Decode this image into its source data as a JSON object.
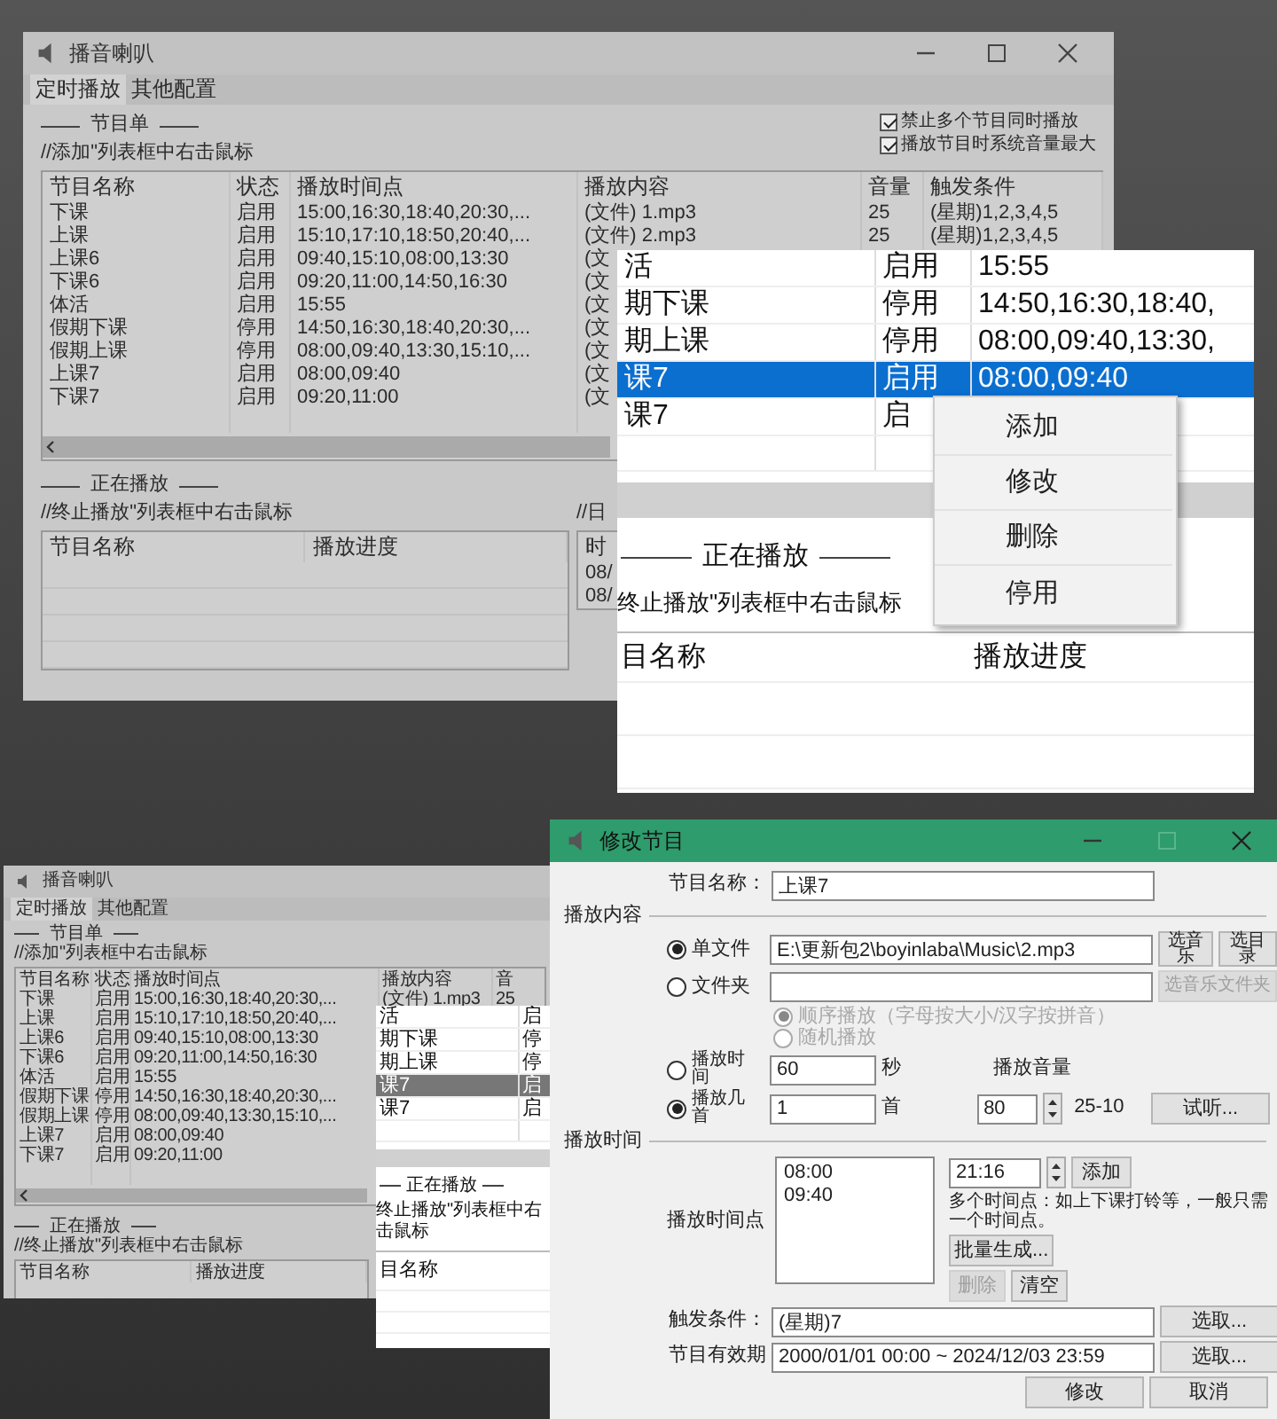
{
  "main_window": {
    "title": "播音喇叭",
    "tabs": [
      {
        "label": "定时播放",
        "selected": true
      },
      {
        "label": "其他配置",
        "selected": false
      }
    ],
    "schedule": {
      "heading": "节目单",
      "hint": "//添加\"列表框中右击鼠标",
      "options": [
        {
          "label": "禁止多个节目同时播放",
          "checked": true
        },
        {
          "label": "播放节目时系统音量最大",
          "checked": true
        }
      ],
      "columns": [
        "节目名称",
        "状态",
        "播放时间点",
        "播放内容",
        "音量",
        "触发条件"
      ],
      "rows": [
        {
          "cells": [
            "下课",
            "启用",
            "15:00,16:30,18:40,20:30,...",
            "(文件) 1.mp3",
            "25",
            "(星期)1,2,3,4,5"
          ]
        },
        {
          "cells": [
            "上课",
            "启用",
            "15:10,17:10,18:50,20:40,...",
            "(文件) 2.mp3",
            "25",
            "(星期)1,2,3,4,5"
          ]
        },
        {
          "cells": [
            "上课6",
            "启用",
            "09:40,15:10,08:00,13:30",
            "(文"
          ]
        },
        {
          "cells": [
            "下课6",
            "启用",
            "09:20,11:00,14:50,16:30",
            "(文"
          ]
        },
        {
          "cells": [
            "体活",
            "启用",
            "15:55",
            "(文"
          ]
        },
        {
          "cells": [
            "假期下课",
            "停用",
            "14:50,16:30,18:40,20:30,...",
            "(文"
          ]
        },
        {
          "cells": [
            "假期上课",
            "停用",
            "08:00,09:40,13:30,15:10,...",
            "(文"
          ]
        },
        {
          "cells": [
            "上课7",
            "启用",
            "08:00,09:40",
            "(文"
          ]
        },
        {
          "cells": [
            "下课7",
            "启用",
            "09:20,11:00",
            "(文"
          ]
        }
      ]
    },
    "playing": {
      "heading": "正在播放",
      "hint": "//终止播放\"列表框中右击鼠标",
      "columns": [
        "节目名称",
        "播放进度"
      ]
    },
    "log": {
      "hint": "//日",
      "column": "时",
      "rows": [
        "08/",
        "08/"
      ]
    }
  },
  "zoom_inset": {
    "rows": [
      {
        "cells": [
          "活",
          "启用",
          "15:55"
        ],
        "selected": false
      },
      {
        "cells": [
          "期下课",
          "停用",
          "14:50,16:30,18:40,"
        ],
        "selected": false
      },
      {
        "cells": [
          "期上课",
          "停用",
          "08:00,09:40,13:30,"
        ],
        "selected": false
      },
      {
        "cells": [
          "课7",
          "启用",
          "08:00,09:40"
        ],
        "selected": true
      },
      {
        "cells": [
          "课7",
          "启"
        ],
        "selected": false
      }
    ],
    "playing_heading": "正在播放",
    "playing_hint": "终止播放\"列表框中右击鼠标",
    "playing_columns": [
      "目名称",
      "播放进度"
    ],
    "context_menu": [
      "添加",
      "修改",
      "删除",
      "停用"
    ]
  },
  "thumbnail_window": {
    "title": "播音喇叭",
    "tabs": [
      {
        "label": "定时播放",
        "selected": true
      },
      {
        "label": "其他配置",
        "selected": false
      }
    ],
    "schedule": {
      "heading": "节目单",
      "hint": "//添加\"列表框中右击鼠标",
      "columns": [
        "节目名称",
        "状态",
        "播放时间点",
        "播放内容",
        "音"
      ],
      "rows": [
        {
          "cells": [
            "下课",
            "启用",
            "15:00,16:30,18:40,20:30,...",
            "(文件) 1.mp3",
            "25"
          ]
        },
        {
          "cells": [
            "上课",
            "启用",
            "15:10,17:10,18:50,20:40,..."
          ]
        },
        {
          "cells": [
            "上课6",
            "启用",
            "09:40,15:10,08:00,13:30"
          ]
        },
        {
          "cells": [
            "下课6",
            "启用",
            "09:20,11:00,14:50,16:30"
          ]
        },
        {
          "cells": [
            "体活",
            "启用",
            "15:55"
          ]
        },
        {
          "cells": [
            "假期下课",
            "停用",
            "14:50,16:30,18:40,20:30,..."
          ]
        },
        {
          "cells": [
            "假期上课",
            "停用",
            "08:00,09:40,13:30,15:10,..."
          ]
        },
        {
          "cells": [
            "上课7",
            "启用",
            "08:00,09:40"
          ]
        },
        {
          "cells": [
            "下课7",
            "启用",
            "09:20,11:00"
          ]
        }
      ]
    },
    "playing": {
      "heading": "正在播放",
      "hint": "//终止播放\"列表框中右击鼠标",
      "columns": [
        "节目名称",
        "播放进度"
      ]
    }
  },
  "thumbnail_inset": {
    "rows": [
      {
        "cells": [
          "活",
          "启"
        ],
        "selected": false
      },
      {
        "cells": [
          "期下课",
          "停"
        ],
        "selected": false
      },
      {
        "cells": [
          "期上课",
          "停"
        ],
        "selected": false
      },
      {
        "cells": [
          "课7",
          "启"
        ],
        "selected": true
      },
      {
        "cells": [
          "课7",
          "启"
        ],
        "selected": false
      }
    ],
    "playing_heading": "正在播放",
    "playing_hint": "终止播放\"列表框中右击鼠标",
    "playing_columns": [
      "目名称"
    ]
  },
  "dialog": {
    "title": "修改节目",
    "name_label": "节目名称：",
    "name_value": "上课7",
    "content_heading": "播放内容",
    "sources": [
      {
        "label": "单文件",
        "selected": true,
        "value": "E:\\更新包2\\boyinlaba\\Music\\2.mp3",
        "buttons": [
          {
            "label": "选音乐",
            "disabled": false
          },
          {
            "label": "选目录",
            "disabled": false
          }
        ]
      },
      {
        "label": "文件夹",
        "selected": false,
        "buttons": [
          {
            "label": "选音乐文件夹",
            "disabled": true
          }
        ]
      }
    ],
    "order": [
      {
        "label": "顺序播放（字母按大小/汉字按拼音）",
        "selected": true,
        "disabled": true
      },
      {
        "label": "随机播放",
        "selected": false,
        "disabled": true
      }
    ],
    "modes": [
      {
        "label": "播放时间",
        "selected": false,
        "value": "60",
        "unit": "秒"
      },
      {
        "label": "播放几首",
        "selected": true,
        "value": "1",
        "unit": "首"
      }
    ],
    "volume": {
      "label": "播放音量",
      "value": "80",
      "range": "25-10",
      "button": "试听..."
    },
    "time_heading": "播放时间",
    "times_label": "播放时间点",
    "times": [
      "08:00",
      "09:40"
    ],
    "time_value": "21:16",
    "add_button": "添加",
    "note": "多个时间点：如上下课打铃等，一般只需一个时间点。",
    "batch_button": "批量生成...",
    "list_buttons": [
      {
        "label": "删除",
        "disabled": true
      },
      {
        "label": "清空",
        "disabled": false
      }
    ],
    "trigger_label": "触发条件：",
    "trigger_value": "(星期)7",
    "validity_label": "节目有效期",
    "validity_value": "2000/01/01 00:00 ~ 2024/12/03 23:59",
    "trigger_button": "选取...",
    "validity_button": "选取...",
    "buttons": [
      "修改",
      "取消"
    ]
  }
}
